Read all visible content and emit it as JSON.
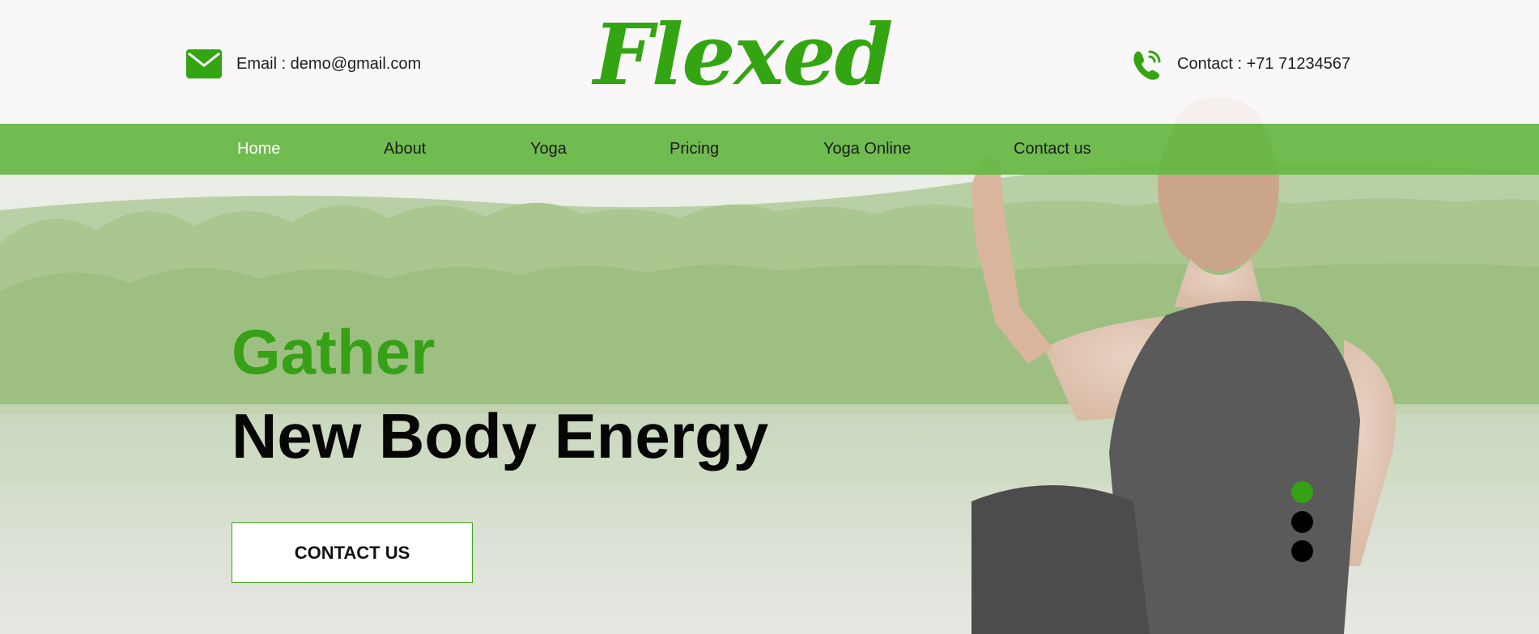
{
  "header": {
    "email_text": "Email : demo@gmail.com",
    "phone_text": "Contact : +71 71234567",
    "logo_text": "Flexed",
    "icons": {
      "email": "envelope-icon",
      "phone": "phone-ringing-icon"
    }
  },
  "nav": {
    "items": [
      {
        "label": "Home",
        "active": true
      },
      {
        "label": "About",
        "active": false
      },
      {
        "label": "Yoga",
        "active": false
      },
      {
        "label": "Pricing",
        "active": false
      },
      {
        "label": "Yoga Online",
        "active": false
      },
      {
        "label": "Contact us",
        "active": false
      }
    ]
  },
  "hero": {
    "line1": "Gather",
    "line2": "New Body Energy",
    "cta_label": "CONTACT US",
    "slides": {
      "count": 3,
      "active_index": 0
    }
  },
  "colors": {
    "brand_green": "#34a512",
    "nav_green": "#66b845",
    "text_dark": "#060606",
    "dot_inactive": "#000000"
  }
}
